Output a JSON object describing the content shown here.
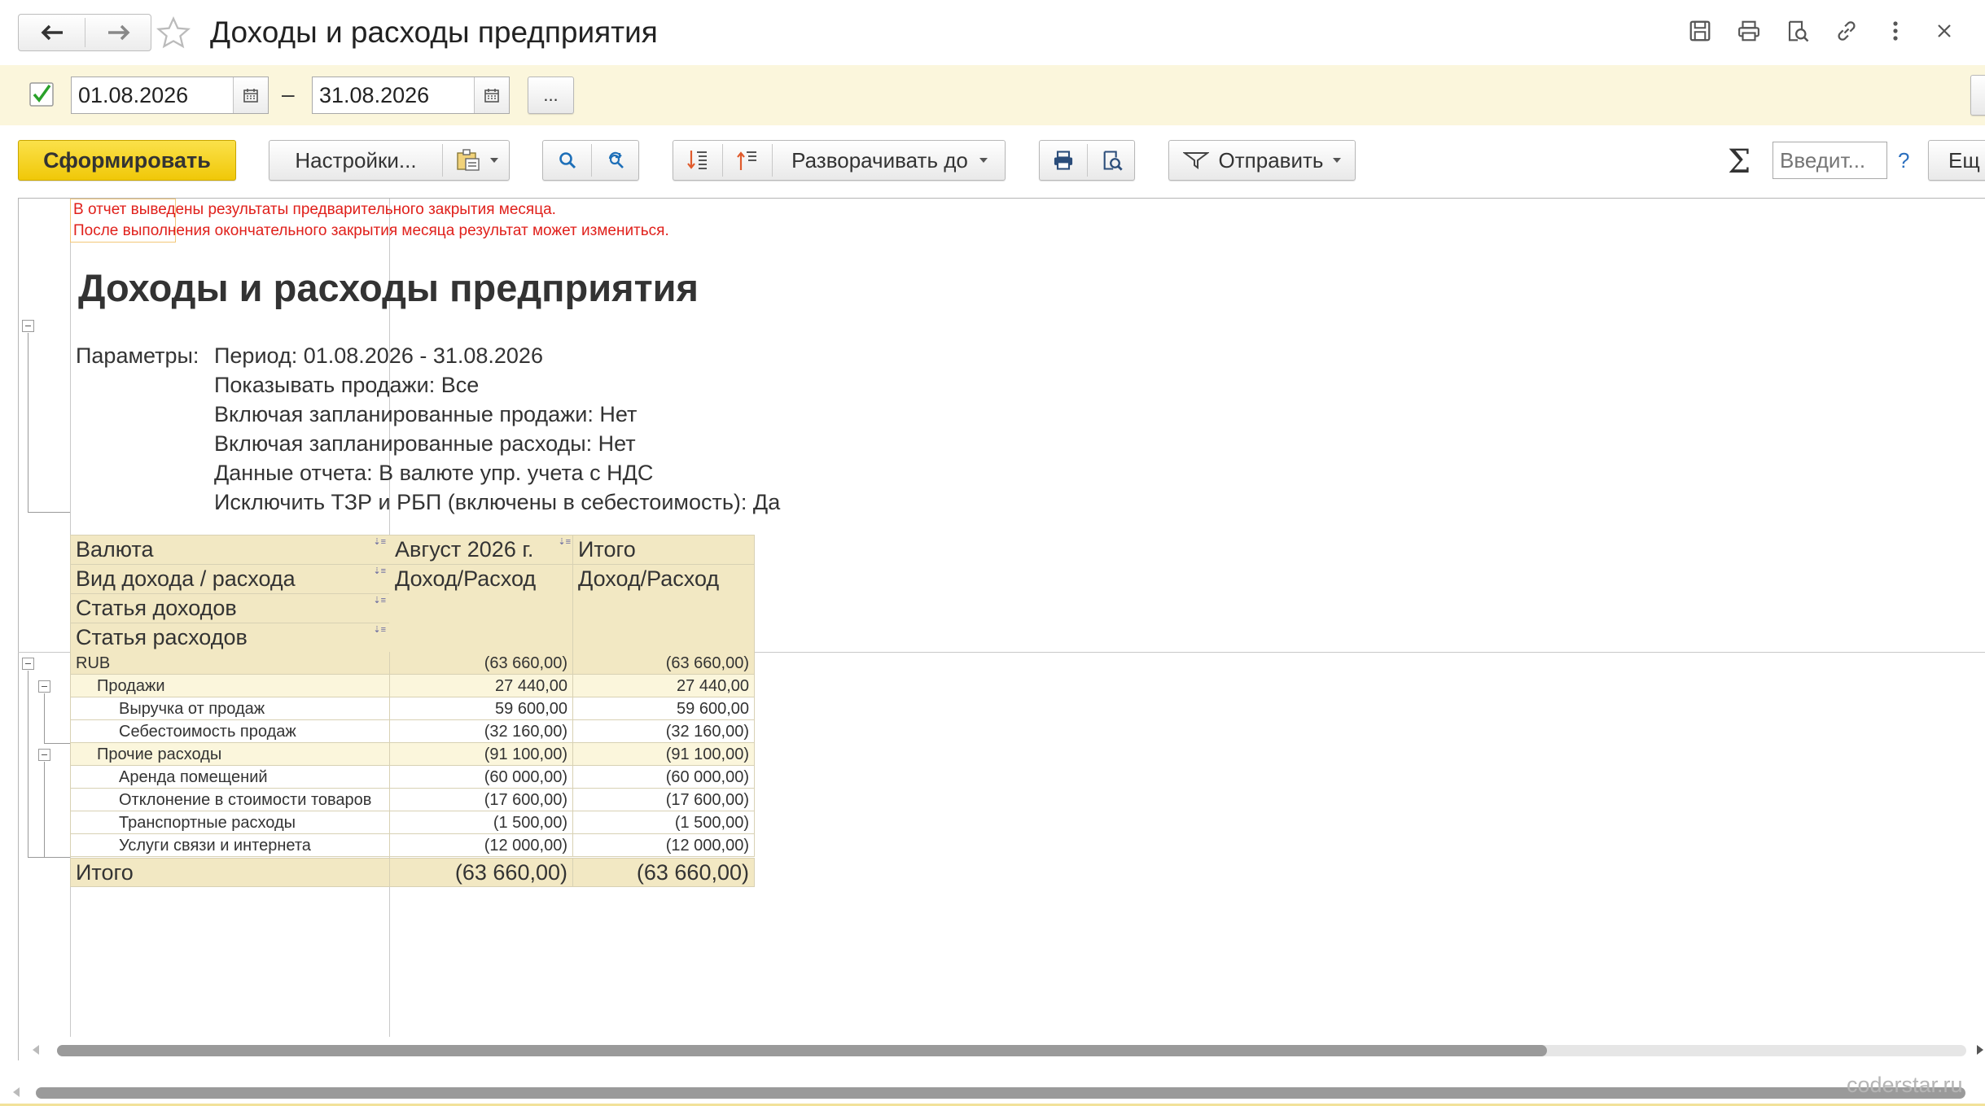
{
  "window": {
    "title": "Доходы и расходы предприятия"
  },
  "period": {
    "enabled": true,
    "date_from": "01.08.2026",
    "separator": "–",
    "date_to": "31.08.2026",
    "more_label": "..."
  },
  "toolbar": {
    "generate_label": "Сформировать",
    "settings_label": "Настройки...",
    "expand_label": "Разворачивать до",
    "send_label": "Отправить",
    "search_placeholder": "Введит...",
    "help_label": "?",
    "more_label": "Ещ"
  },
  "report": {
    "warning_line1": "В отчет выведены результаты предварительного закрытия месяца.",
    "warning_line2": "После выполнения окончательного закрытия месяца результат может измениться.",
    "title": "Доходы и расходы предприятия",
    "params_label": "Параметры:",
    "params": [
      "Период: 01.08.2026 - 31.08.2026",
      "Показывать продажи: Все",
      "Включая запланированные продажи: Нет",
      "Включая запланированные расходы: Нет",
      "Данные отчета: В валюте упр. учета с НДС",
      "Исключить ТЗР и РБП (включены в себестоимость): Да"
    ],
    "header_rows": [
      "Валюта",
      "Вид дохода / расхода",
      "Статья доходов",
      "Статья расходов"
    ],
    "col_month": "Август 2026 г.",
    "col_month_sub": "Доход/Расход",
    "col_total": "Итого",
    "col_total_sub": "Доход/Расход",
    "rows": [
      {
        "label": "RUB",
        "level": 0,
        "month": "(63 660,00)",
        "total": "(63 660,00)"
      },
      {
        "label": "Продажи",
        "level": 1,
        "month": "27 440,00",
        "total": "27 440,00"
      },
      {
        "label": "Выручка от продаж",
        "level": 2,
        "month": "59 600,00",
        "total": "59 600,00"
      },
      {
        "label": "Себестоимость продаж",
        "level": 2,
        "month": "(32 160,00)",
        "total": "(32 160,00)"
      },
      {
        "label": "Прочие расходы",
        "level": 1,
        "month": "(91 100,00)",
        "total": "(91 100,00)"
      },
      {
        "label": "Аренда помещений",
        "level": 2,
        "month": "(60 000,00)",
        "total": "(60 000,00)"
      },
      {
        "label": "Отклонение в стоимости товаров",
        "level": 2,
        "month": "(17 600,00)",
        "total": "(17 600,00)"
      },
      {
        "label": "Транспортные расходы",
        "level": 2,
        "month": "(1 500,00)",
        "total": "(1 500,00)"
      },
      {
        "label": "Услуги связи и интернета",
        "level": 2,
        "month": "(12 000,00)",
        "total": "(12 000,00)"
      }
    ],
    "grand_total_label": "Итого",
    "grand_total_month": "(63 660,00)",
    "grand_total_total": "(63 660,00)"
  },
  "watermark": "coderstar.ru",
  "colors": {
    "accent_yellow": "#f5d20a",
    "header_fill": "#f2e8c3",
    "period_bar": "#fbf6dc",
    "warning_red": "#e0201b"
  }
}
